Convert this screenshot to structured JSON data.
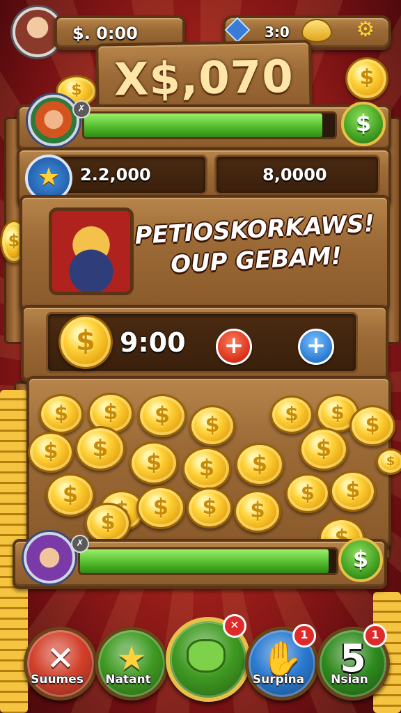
{
  "top_bar": {
    "money": "$. 0:00",
    "gem_value": "3:0",
    "settings_icon": "gear-icon",
    "currency_icon": "gem-icon"
  },
  "title_sign": {
    "text": "X$,070"
  },
  "stats": {
    "left_value": "2.2,000",
    "right_value": "8,0000"
  },
  "banner": {
    "line1": "PETIOSKORKAWS!",
    "line2": "OUP GEBAM!"
  },
  "counter": {
    "value": "9:00",
    "coin_symbol": "$",
    "plus_symbol": "+"
  },
  "progress": {
    "top_fill_fraction": 0.95,
    "bottom_fill_fraction": 0.97,
    "badge_symbol": "✗",
    "button_symbol": "$"
  },
  "coin_symbol": "$",
  "bottom_nav": [
    {
      "label": "Suumes",
      "icon": "close-icon",
      "glyph": "✕",
      "color": "#d2402a",
      "badge": ""
    },
    {
      "label": "Natant",
      "icon": "star-icon",
      "glyph": "★",
      "color": "#3f9a22",
      "badge": ""
    },
    {
      "label": "",
      "icon": "frog-icon",
      "glyph": "",
      "color": "#3f9a22",
      "badge": "✕"
    },
    {
      "label": "Surpina",
      "icon": "glove-icon",
      "glyph": "✋",
      "color": "#2a7ad0",
      "badge": "1"
    },
    {
      "label": "Nsian",
      "icon": "five-icon",
      "glyph": "5",
      "color": "#2f8a1e",
      "badge": "1"
    }
  ],
  "colors": {
    "accent_green": "#4fb82a",
    "accent_gold": "#ffd23a",
    "wood": "#9b6a36",
    "alert_red": "#e02a2a"
  }
}
